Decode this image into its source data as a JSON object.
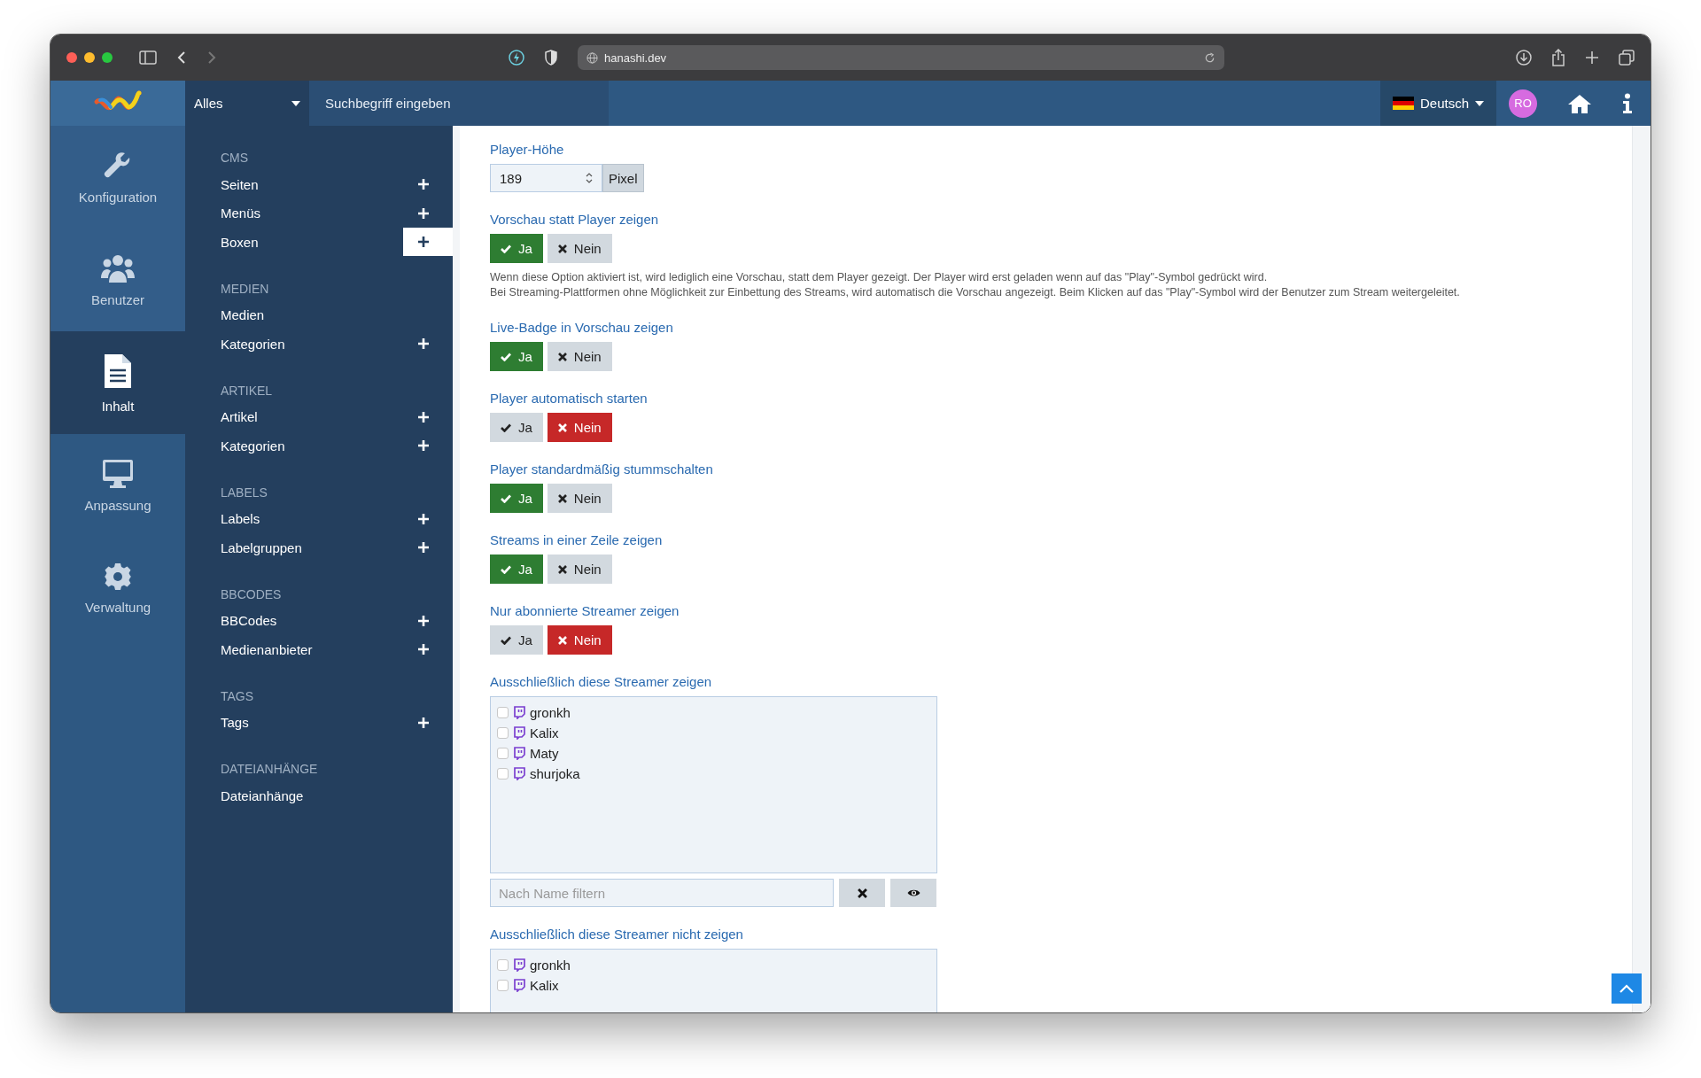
{
  "browser": {
    "url": "hanashi.dev"
  },
  "header": {
    "search_scope": "Alles",
    "search_placeholder": "Suchbegriff eingeben",
    "language": "Deutsch",
    "avatar": "RO"
  },
  "sidebar": {
    "items": [
      {
        "label": "Konfiguration",
        "kind": "wrench",
        "selected": false
      },
      {
        "label": "Benutzer",
        "kind": "users",
        "selected": false
      },
      {
        "label": "Inhalt",
        "kind": "file",
        "selected": true
      },
      {
        "label": "Anpassung",
        "kind": "monitor",
        "selected": false
      },
      {
        "label": "Verwaltung",
        "kind": "gear",
        "selected": false
      }
    ]
  },
  "nav": {
    "groups": [
      {
        "heading": "CMS",
        "items": [
          {
            "label": "Seiten",
            "add": true,
            "add_highlighted": false
          },
          {
            "label": "Menüs",
            "add": true,
            "add_highlighted": false
          },
          {
            "label": "Boxen",
            "add": true,
            "add_highlighted": true
          }
        ]
      },
      {
        "heading": "MEDIEN",
        "items": [
          {
            "label": "Medien",
            "add": false
          },
          {
            "label": "Kategorien",
            "add": true,
            "add_highlighted": false
          }
        ]
      },
      {
        "heading": "ARTIKEL",
        "items": [
          {
            "label": "Artikel",
            "add": true,
            "add_highlighted": false
          },
          {
            "label": "Kategorien",
            "add": true,
            "add_highlighted": false
          }
        ]
      },
      {
        "heading": "LABELS",
        "items": [
          {
            "label": "Labels",
            "add": true,
            "add_highlighted": false
          },
          {
            "label": "Labelgruppen",
            "add": true,
            "add_highlighted": false
          }
        ]
      },
      {
        "heading": "BBCODES",
        "items": [
          {
            "label": "BBCodes",
            "add": true,
            "add_highlighted": false
          },
          {
            "label": "Medienanbieter",
            "add": true,
            "add_highlighted": false
          }
        ]
      },
      {
        "heading": "TAGS",
        "items": [
          {
            "label": "Tags",
            "add": true,
            "add_highlighted": false
          }
        ]
      },
      {
        "heading": "DATEIANHÄNGE",
        "items": [
          {
            "label": "Dateianhänge",
            "add": false
          }
        ]
      }
    ]
  },
  "settings": [
    {
      "kind": "number",
      "label": "Player-Höhe",
      "value": "189",
      "unit": "Pixel"
    },
    {
      "kind": "toggle",
      "label": "Vorschau statt Player zeigen",
      "options": [
        {
          "label": "Ja",
          "selected": true
        },
        {
          "label": "Nein",
          "selected": false
        }
      ],
      "help": [
        "Wenn diese Option aktiviert ist, wird lediglich eine Vorschau, statt dem Player gezeigt. Der Player wird erst geladen wenn auf das \"Play\"-Symbol gedrückt wird.",
        "Bei Streaming-Plattformen ohne Möglichkeit zur Einbettung des Streams, wird automatisch die Vorschau angezeigt. Beim Klicken auf das \"Play\"-Symbol wird der Benutzer zum Stream weitergeleitet."
      ]
    },
    {
      "kind": "toggle",
      "label": "Live-Badge in Vorschau zeigen",
      "options": [
        {
          "label": "Ja",
          "selected": true
        },
        {
          "label": "Nein",
          "selected": false
        }
      ]
    },
    {
      "kind": "toggle",
      "label": "Player automatisch starten",
      "options": [
        {
          "label": "Ja",
          "selected": false
        },
        {
          "label": "Nein",
          "selected": true
        }
      ]
    },
    {
      "kind": "toggle",
      "label": "Player standardmäßig stummschalten",
      "options": [
        {
          "label": "Ja",
          "selected": true
        },
        {
          "label": "Nein",
          "selected": false
        }
      ]
    },
    {
      "kind": "toggle",
      "label": "Streams in einer Zeile zeigen",
      "options": [
        {
          "label": "Ja",
          "selected": true
        },
        {
          "label": "Nein",
          "selected": false
        }
      ]
    },
    {
      "kind": "toggle",
      "label": "Nur abonnierte Streamer zeigen",
      "options": [
        {
          "label": "Ja",
          "selected": false
        },
        {
          "label": "Nein",
          "selected": true
        }
      ]
    },
    {
      "kind": "multiselect",
      "label": "Ausschließlich diese Streamer zeigen",
      "filter_placeholder": "Nach Name filtern",
      "items": [
        {
          "label": "gronkh",
          "checked": false
        },
        {
          "label": "Kalix",
          "checked": false
        },
        {
          "label": "Maty",
          "checked": false
        },
        {
          "label": "shurjoka",
          "checked": false
        }
      ]
    },
    {
      "kind": "multiselect",
      "label": "Ausschließlich diese Streamer nicht zeigen",
      "items": [
        {
          "label": "gronkh",
          "checked": false
        },
        {
          "label": "Kalix",
          "checked": false
        }
      ]
    }
  ]
}
